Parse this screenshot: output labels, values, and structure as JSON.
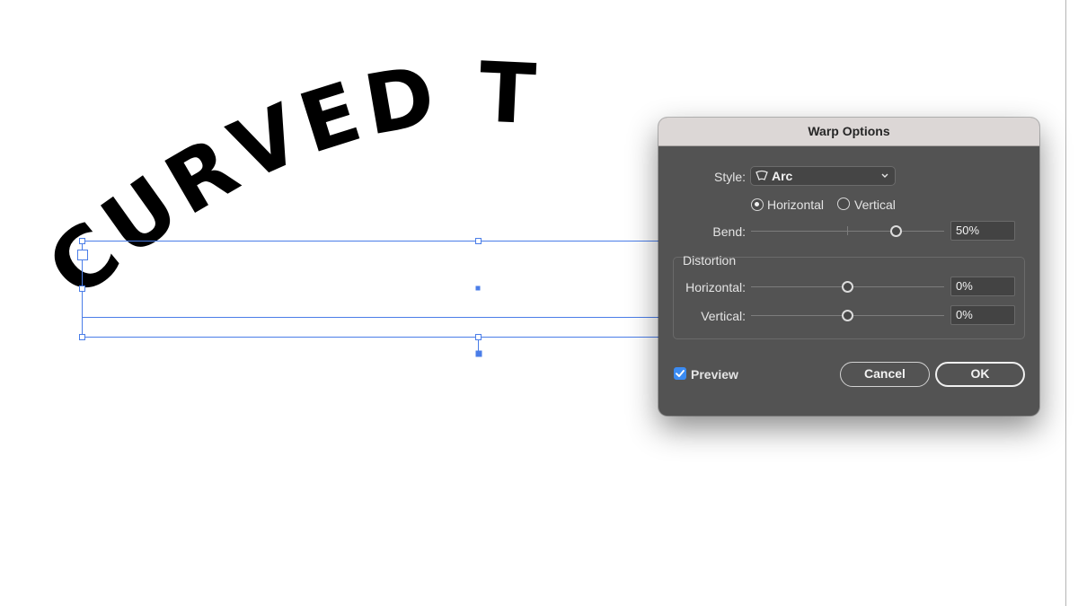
{
  "canvas": {
    "warped_text": "CURVED T"
  },
  "dialog": {
    "title": "Warp Options",
    "style_label": "Style:",
    "style_value": "Arc",
    "style_icon": "arc-icon",
    "orientation": {
      "horizontal_label": "Horizontal",
      "vertical_label": "Vertical",
      "selected": "Horizontal"
    },
    "bend": {
      "label": "Bend:",
      "value": "50%",
      "level": 50
    },
    "distortion": {
      "group_label": "Distortion",
      "horizontal_label": "Horizontal:",
      "horizontal_value": "0%",
      "horizontal_level": 0,
      "vertical_label": "Vertical:",
      "vertical_value": "0%",
      "vertical_level": 0
    },
    "preview": {
      "label": "Preview",
      "checked": true
    },
    "cancel_label": "Cancel",
    "ok_label": "OK"
  },
  "colors": {
    "selection": "#4a7de8",
    "dialog_bg": "#535353",
    "titlebar_bg": "#dcd7d6",
    "checkbox_accent": "#3b8bf2"
  }
}
